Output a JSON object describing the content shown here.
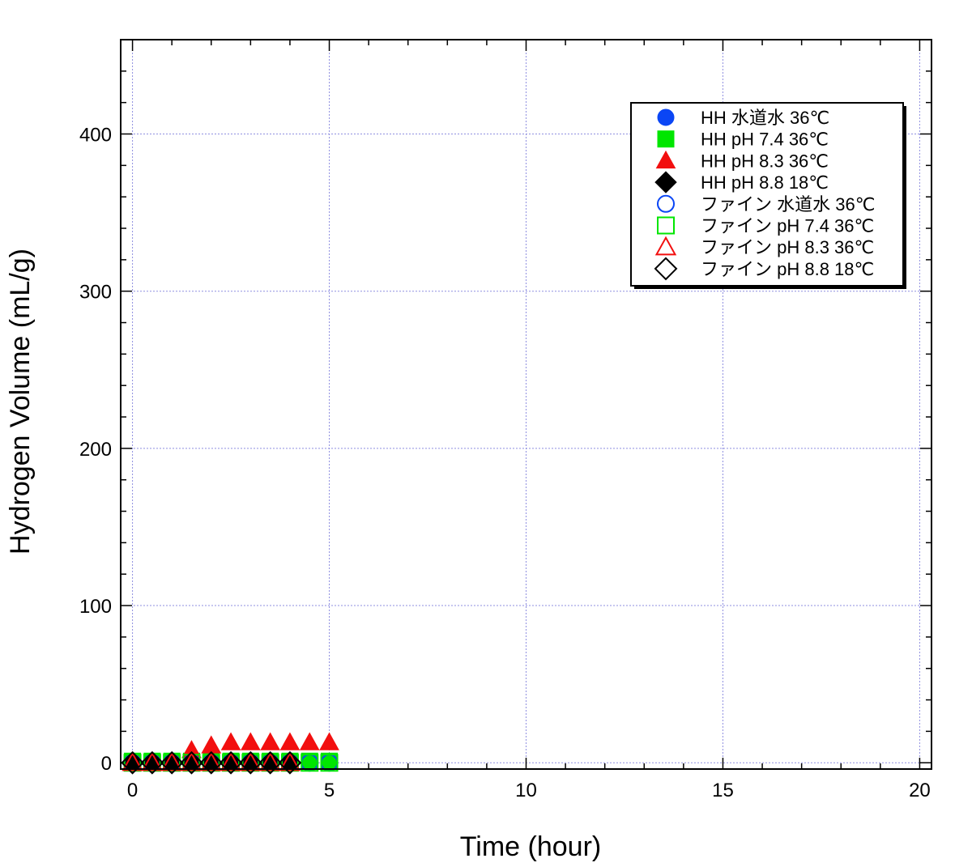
{
  "chart_data": {
    "type": "scatter",
    "xlabel": "Time (hour)",
    "ylabel": "Hydrogen Volume (mL/g)",
    "xlim": [
      -0.3,
      20.3
    ],
    "ylim": [
      -4,
      460
    ],
    "xticks": [
      0,
      5,
      10,
      15,
      20
    ],
    "yticks": [
      0,
      100,
      200,
      300,
      400
    ],
    "grid": true,
    "legend_position": "top-right",
    "series": [
      {
        "name": "HH 水道水 36℃",
        "marker": "circle",
        "filled": true,
        "color": "#0b46f5",
        "x": [
          0,
          0.5,
          1,
          1.5,
          2,
          2.5,
          3,
          3.5,
          4,
          4.5,
          5
        ],
        "y": [
          0,
          0,
          0,
          0,
          0,
          0,
          0,
          0,
          0,
          0,
          0
        ]
      },
      {
        "name": "HH pH 7.4 36℃",
        "marker": "square",
        "filled": true,
        "color": "#00e600",
        "x": [
          0,
          0.5,
          1,
          1.5,
          2,
          2.5,
          3,
          3.5,
          4,
          4.5,
          5
        ],
        "y": [
          1,
          1,
          1,
          1,
          1,
          1,
          1,
          1,
          1,
          1,
          1
        ]
      },
      {
        "name": "HH pH 8.3 36℃",
        "marker": "triangle",
        "filled": true,
        "color": "#f20f0f",
        "x": [
          0,
          0.5,
          1,
          1.5,
          2,
          2.5,
          3,
          3.5,
          4,
          4.5,
          5
        ],
        "y": [
          0,
          0,
          0,
          8,
          11,
          13,
          13,
          13,
          13,
          13,
          13
        ]
      },
      {
        "name": "HH pH 8.8 18℃",
        "marker": "diamond",
        "filled": true,
        "color": "#000000",
        "x": [
          0,
          0.5,
          1,
          1.5,
          2,
          2.5,
          3,
          3.5,
          4
        ],
        "y": [
          0,
          0,
          0,
          0,
          0,
          0,
          0,
          0,
          0
        ]
      },
      {
        "name": "ファイン 水道水 36℃",
        "marker": "circle",
        "filled": false,
        "color": "#0b46f5",
        "x": [
          0,
          0.5,
          1,
          1.5,
          2,
          2.5,
          3,
          3.5,
          4,
          4.5,
          5
        ],
        "y": [
          0,
          0,
          0,
          0,
          0,
          0,
          0,
          0,
          0,
          0,
          0
        ]
      },
      {
        "name": "ファイン pH 7.4 36℃",
        "marker": "square",
        "filled": false,
        "color": "#00e600",
        "x": [
          0,
          0.5,
          1,
          1.5,
          2,
          2.5,
          3,
          3.5,
          4,
          4.5,
          5
        ],
        "y": [
          0,
          0,
          0,
          0,
          0,
          0,
          0,
          0,
          0,
          0,
          0
        ]
      },
      {
        "name": "ファイン pH 8.3 36℃",
        "marker": "triangle",
        "filled": false,
        "color": "#f20f0f",
        "x": [
          0,
          0.5,
          1,
          1.5,
          2,
          2.5,
          3,
          3.5,
          4
        ],
        "y": [
          0,
          0,
          0,
          0,
          0,
          0,
          0,
          0,
          0
        ]
      },
      {
        "name": "ファイン pH 8.8 18℃",
        "marker": "diamond",
        "filled": false,
        "color": "#000000",
        "x": [
          0,
          0.5,
          1,
          1.5,
          2,
          2.5,
          3,
          3.5,
          4
        ],
        "y": [
          0,
          0,
          0,
          0,
          0,
          0,
          0,
          0,
          0
        ]
      }
    ]
  }
}
